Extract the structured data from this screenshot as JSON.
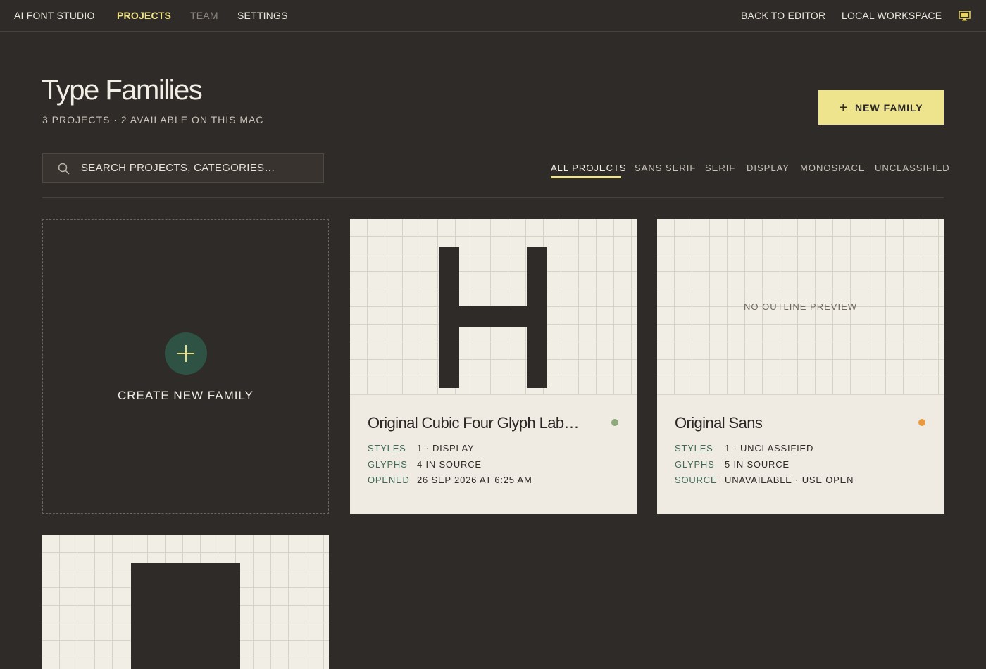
{
  "topnav": {
    "brand": "AI FONT STUDIO",
    "projects": "PROJECTS",
    "team": "TEAM",
    "settings": "SETTINGS",
    "back_to_editor": "BACK TO EDITOR",
    "local_workspace": "LOCAL WORKSPACE",
    "monitor_icon": "monitor-icon"
  },
  "header": {
    "title": "Type Families",
    "subtitle": "3 PROJECTS · 2 AVAILABLE ON THIS MAC",
    "new_family_label": "NEW FAMILY"
  },
  "search": {
    "placeholder": "SEARCH PROJECTS, CATEGORIES…",
    "value": ""
  },
  "filters": {
    "all": "ALL PROJECTS",
    "sans_serif": "SANS SERIF",
    "serif": "SERIF",
    "display": "DISPLAY",
    "monospace": "MONOSPACE",
    "unclassified": "UNCLASSIFIED",
    "selected": "ALL PROJECTS"
  },
  "create_card": {
    "label": "CREATE NEW FAMILY"
  },
  "projects": [
    {
      "name": "Original Cubic Four Glyph Lab…",
      "status_color": "#8da87a",
      "meta": [
        {
          "key": "STYLES",
          "value": "1 · DISPLAY"
        },
        {
          "key": "GLYPHS",
          "value": "4 IN SOURCE"
        },
        {
          "key": "OPENED",
          "value": "26 SEP 2026 AT 6:25 AM"
        }
      ]
    },
    {
      "name": "Original Sans",
      "status_color": "#ec9a3e",
      "preview_text": "NO OUTLINE PREVIEW",
      "meta": [
        {
          "key": "STYLES",
          "value": "1 · UNCLASSIFIED"
        },
        {
          "key": "GLYPHS",
          "value": "5 IN SOURCE"
        },
        {
          "key": "SOURCE",
          "value": "UNAVAILABLE · USE OPEN"
        }
      ]
    }
  ],
  "colors": {
    "accent": "#ede48d",
    "background": "#2f2b28",
    "card": "#efebe2",
    "meta_key": "#3f6a57"
  }
}
